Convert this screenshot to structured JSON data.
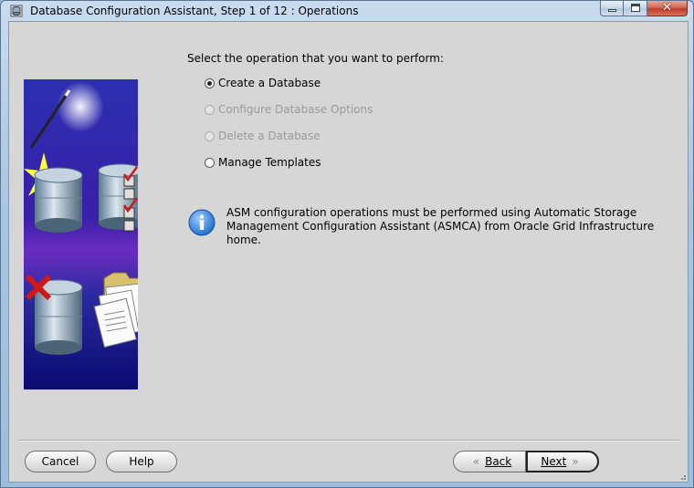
{
  "window": {
    "title": "Database Configuration Assistant, Step 1 of 12 : Operations"
  },
  "main": {
    "prompt": "Select the operation that you want to perform:",
    "options": [
      {
        "label": "Create a Database",
        "selected": true,
        "enabled": true
      },
      {
        "label": "Configure Database Options",
        "selected": false,
        "enabled": false
      },
      {
        "label": "Delete a Database",
        "selected": false,
        "enabled": false
      },
      {
        "label": "Manage Templates",
        "selected": false,
        "enabled": true
      }
    ],
    "info": {
      "icon": "info-icon",
      "line1": "ASM configuration operations must be performed using Automatic Storage",
      "line2": "Management Configuration Assistant (ASMCA) from Oracle Grid Infrastructure home."
    }
  },
  "buttons": {
    "cancel": "Cancel",
    "help": "Help",
    "back": "Back",
    "next": "Next",
    "back_arrow": "«",
    "next_arrow": "»"
  },
  "colors": {
    "banner_bg": "#1a1a7a",
    "info_blue": "#1f6fd0",
    "check_red": "#d01818",
    "client_bg": "#d6d6d6"
  }
}
